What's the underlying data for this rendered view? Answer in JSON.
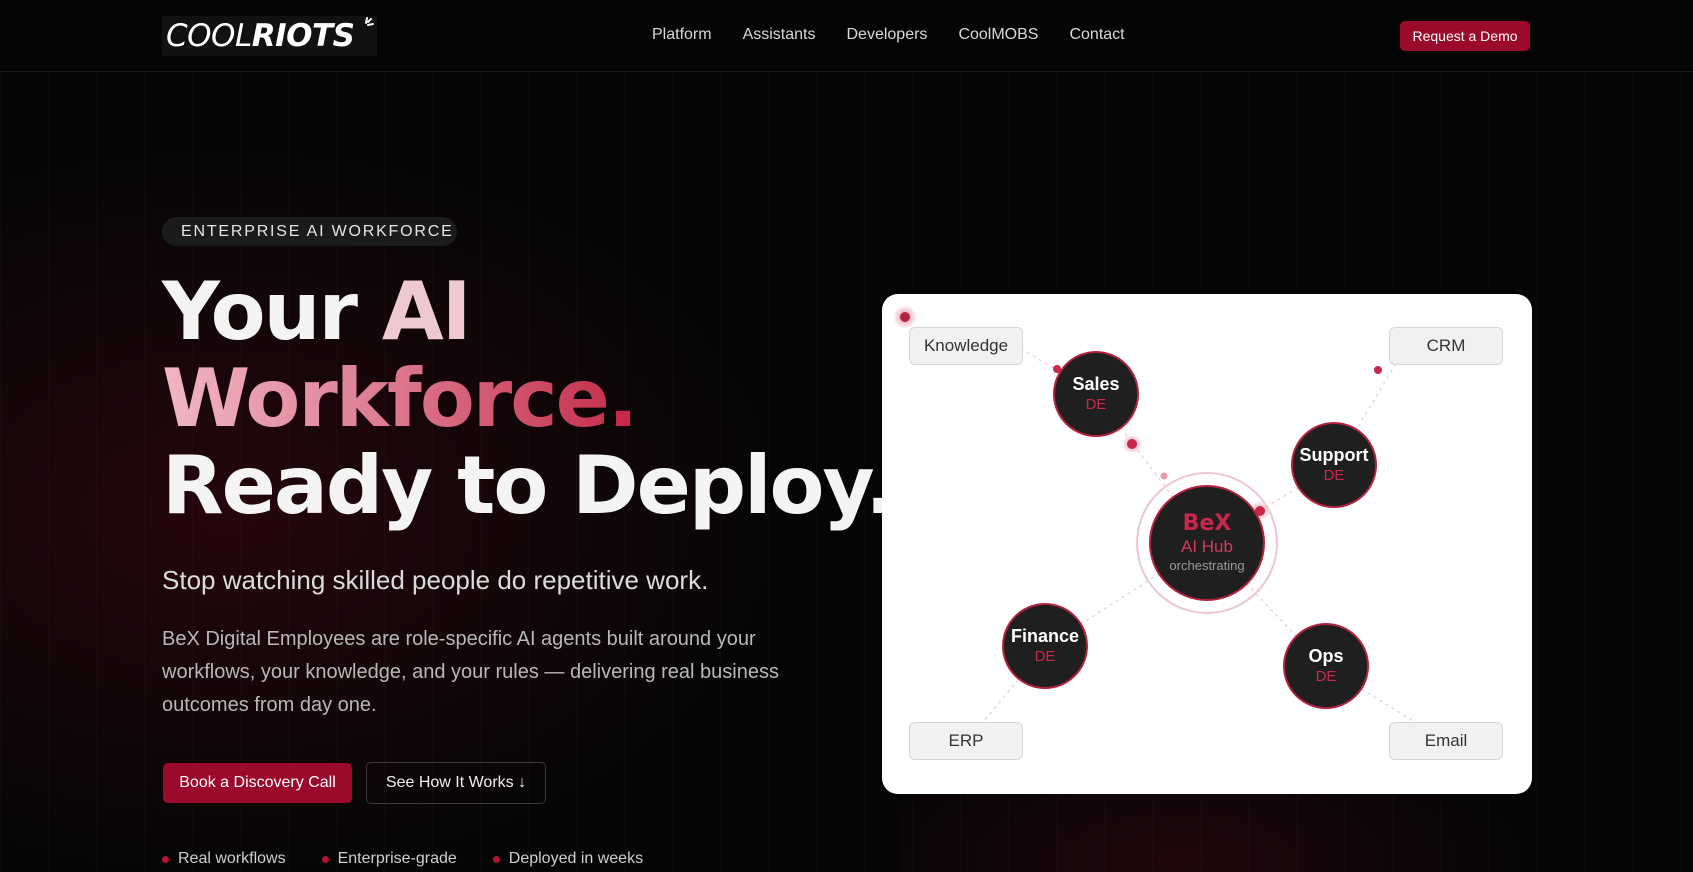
{
  "brand": {
    "logo_light": "COOL",
    "logo_bold": "RIOTS"
  },
  "nav": {
    "links": [
      "Platform",
      "Assistants",
      "Developers",
      "CoolMOBS",
      "Contact"
    ],
    "cta_label": "Request a Demo"
  },
  "hero": {
    "badge": "ENTERPRISE AI WORKFORCE",
    "headline_your": "Your ",
    "headline_ai": "AI",
    "headline_workforce": "Workforce",
    "headline_period": ".",
    "headline_ready": "Ready to Deploy.",
    "subhead": "Stop watching skilled people do repetitive work.",
    "body": "BeX Digital Employees are role-specific AI agents built around your workflows, your knowledge, and your rules — delivering real business outcomes from day one.",
    "primary_cta": "Book a Discovery Call",
    "secondary_cta": "See How It Works ↓",
    "features": [
      "Real workflows",
      "Enterprise-grade",
      "Deployed in weeks"
    ]
  },
  "diagram": {
    "hub": {
      "name": "BeX",
      "subtitle": "AI Hub",
      "status": "orchestrating"
    },
    "agents": [
      {
        "name": "Sales",
        "tag": "DE"
      },
      {
        "name": "Support",
        "tag": "DE"
      },
      {
        "name": "Finance",
        "tag": "DE"
      },
      {
        "name": "Ops",
        "tag": "DE"
      }
    ],
    "systems": [
      "Knowledge",
      "CRM",
      "ERP",
      "Email"
    ]
  },
  "colors": {
    "accent": "#9b0a2a",
    "accent_text": "#c8284a",
    "background": "#050505"
  }
}
